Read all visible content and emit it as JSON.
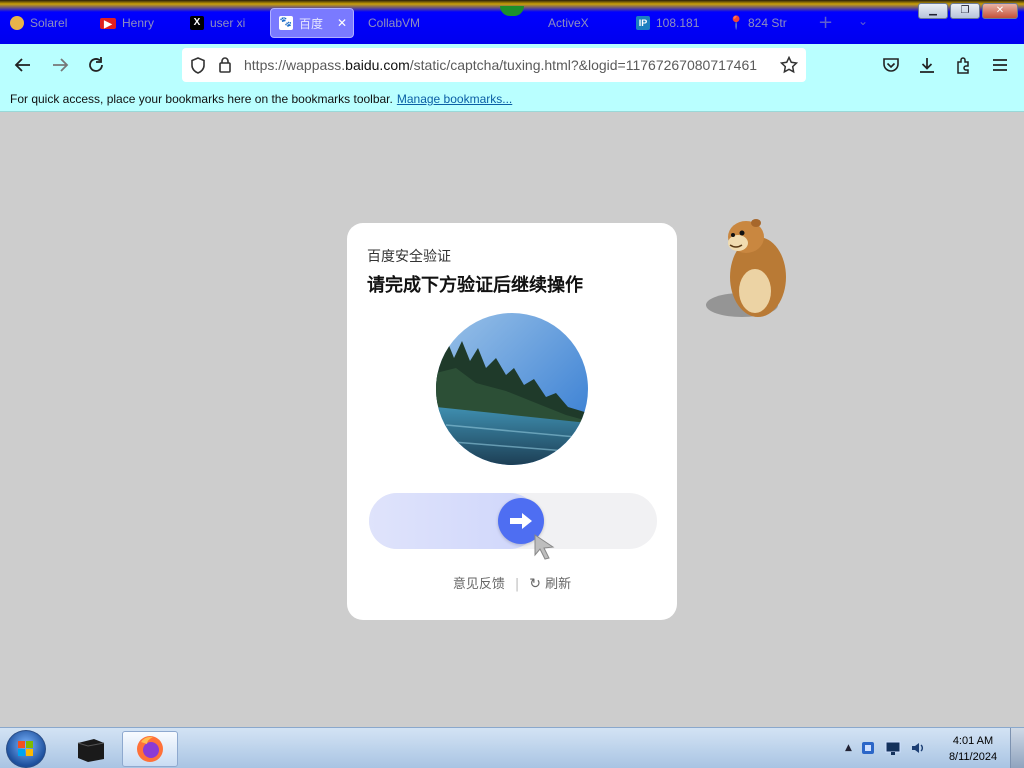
{
  "browser": {
    "tabs": [
      {
        "label": "Solarel",
        "icon": "shield-icon",
        "active": false
      },
      {
        "label": "Henry",
        "icon": "youtube-icon",
        "active": false
      },
      {
        "label": "user xi",
        "icon": "x-icon",
        "active": false
      },
      {
        "label": "百度",
        "icon": "baidu-icon",
        "active": true
      },
      {
        "label": "CollabVM",
        "icon": "collabvm-icon",
        "active": false
      },
      {
        "label": "ActiveX",
        "icon": "page-icon",
        "active": false
      },
      {
        "label": "108.181",
        "icon": "ip-icon",
        "active": false
      },
      {
        "label": "824 Str",
        "icon": "map-pin-icon",
        "active": false
      }
    ],
    "url_prefix": "https://wappass.",
    "url_host": "baidu.com",
    "url_rest": "/static/captcha/tuxing.html?&logid=11767267080717461",
    "bookmarks_text": "For quick access, place your bookmarks here on the bookmarks toolbar.",
    "bookmarks_link": "Manage bookmarks..."
  },
  "captcha": {
    "subtitle": "百度安全验证",
    "title": "请完成下方验证后继续操作",
    "feedback": "意见反馈",
    "separator": "|",
    "refresh": "刷新",
    "slider_progress": 0.45
  },
  "taskbar": {
    "time": "4:01 AM",
    "date": "8/11/2024"
  },
  "colors": {
    "accent": "#4e6ef2",
    "navbar": "#b9ffff",
    "tabstrip": "#0000ff"
  }
}
